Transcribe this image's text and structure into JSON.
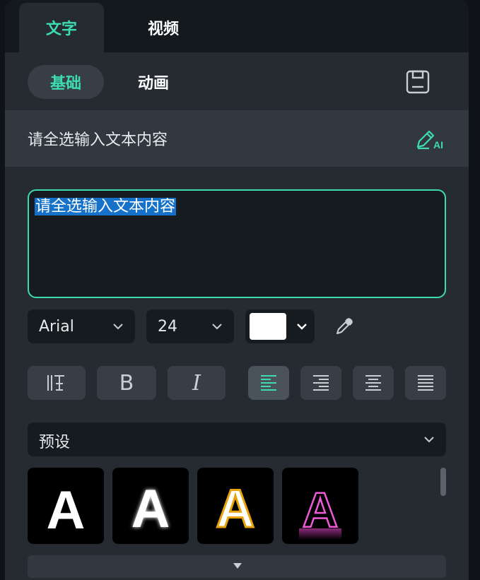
{
  "tabs": {
    "text": "文字",
    "video": "视频"
  },
  "subtabs": {
    "basic": "基础",
    "animation": "动画"
  },
  "prompt": {
    "text": "请全选输入文本内容",
    "ai_label": "AI"
  },
  "editor": {
    "value": "请全选输入文本内容"
  },
  "font": {
    "family": "Arial",
    "size": "24",
    "color": "#ffffff"
  },
  "align": {
    "selected": "left"
  },
  "preset": {
    "label": "预设"
  },
  "presets": [
    {
      "glyph": "A",
      "style": "white-solid"
    },
    {
      "glyph": "A",
      "style": "white-glow"
    },
    {
      "glyph": "A",
      "style": "gold-outline"
    },
    {
      "glyph": "A",
      "style": "pink-neon-outline"
    }
  ],
  "colors": {
    "accent": "#3ddcb0",
    "panel": "#252b31",
    "selection": "#1672c9"
  }
}
